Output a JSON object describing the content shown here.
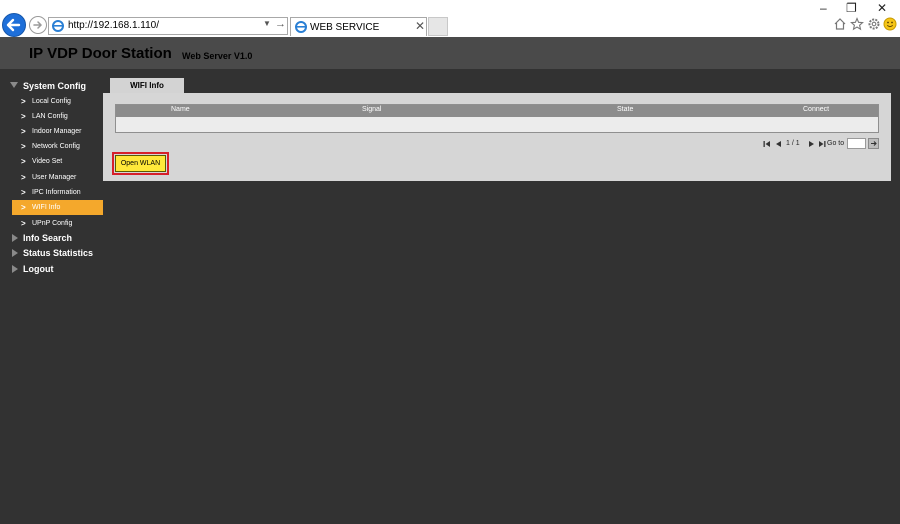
{
  "browser": {
    "address_url": "http://192.168.1.110/",
    "tab_title": "WEB SERVICE",
    "tab_close": "✕",
    "window_controls": {
      "minimize": "–",
      "restore": "❐",
      "close": "✕"
    },
    "toolbar_icons": [
      "home-icon",
      "star-icon",
      "gear-icon",
      "smiley-icon"
    ]
  },
  "app": {
    "title": "IP VDP Door Station",
    "version": "Web Server V1.0"
  },
  "sidebar": {
    "sections": [
      {
        "label": "System Config",
        "expanded": true,
        "items": [
          {
            "label": "Local Config",
            "active": false
          },
          {
            "label": "LAN Config",
            "active": false
          },
          {
            "label": "Indoor Manager",
            "active": false
          },
          {
            "label": "Network Config",
            "active": false
          },
          {
            "label": "Video Set",
            "active": false
          },
          {
            "label": "User Manager",
            "active": false
          },
          {
            "label": "IPC Information",
            "active": false
          },
          {
            "label": "WIFI Info",
            "active": true
          },
          {
            "label": "UPnP Config",
            "active": false
          }
        ]
      },
      {
        "label": "Info Search",
        "expanded": false
      },
      {
        "label": "Status Statistics",
        "expanded": false
      },
      {
        "label": "Logout",
        "expanded": false
      }
    ]
  },
  "main": {
    "tab_label": "WIFI Info",
    "table": {
      "columns": [
        "Name",
        "Signal",
        "State",
        "Connect"
      ],
      "rows": []
    },
    "pager": {
      "page_info": "1 / 1",
      "goto_label": "Go to",
      "goto_value": ""
    },
    "open_wlan_label": "Open WLAN"
  },
  "colors": {
    "page_bg": "#323232",
    "header_bg": "#4a4a4a",
    "active_item": "#f4a82c",
    "button_bg": "#ffe83a",
    "highlight": "#d6202a"
  }
}
